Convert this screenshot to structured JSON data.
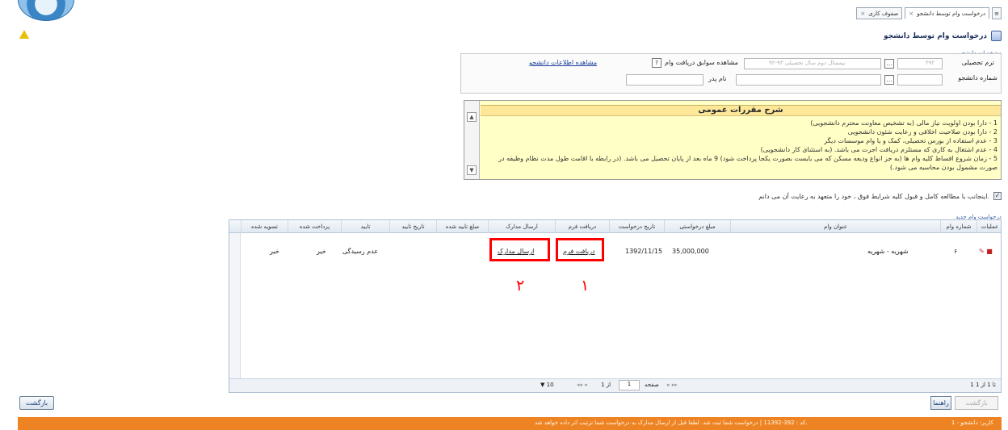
{
  "tabs": [
    {
      "label": "درخواست وام توسط دانشجو",
      "active": true
    },
    {
      "label": "صفوف کاری",
      "active": false
    }
  ],
  "page": {
    "title": "درخواست وام توسط دانشجو"
  },
  "student_info": {
    "legend": "مشخصات دانشجو",
    "term_label": "ترم تحصیلی",
    "term_value": "۴۹۲",
    "term_desc": "نیمسال دوم سال تحصیلی ۹۳-۹۲",
    "student_no_label": "شماره دانشجو",
    "history_label": "مشاهده سوابق دریافت وام",
    "student_details_link": "مشاهده اطلاعات دانشجو",
    "father_label": "نام پدر"
  },
  "rules": {
    "title": "شرح مقررات عمومی",
    "items": [
      "1 - دارا بودن اولویت نیاز مالی (به تشخیص معاونت محترم دانشجویی)",
      "2 - دارا بودن صلاحیت اخلاقی و رعایت شئون دانشجویی",
      "3 - عدم استفاده از بورس تحصیلی، کمک و یا وام موسسات دیگر",
      "4 - عدم اشتغال به کاری که مستلزم دریافت اجرت می باشد. (به استثنای کار دانشجویی)",
      "5 - زمان شروع اقساط کلیه وام ها (به جز انواع ودیعه مسکن که می بایست بصورت یکجا پرداخت شود) 9 ماه بعد از پایان تحصیل می باشد. (در رابطه با اقامت طول مدت نظام وظیفه در صورت مشمول بودن محاسبه می شود.)"
    ]
  },
  "acceptance": {
    "checked": true,
    "text": "اینجانب با مطالعه کامل و قبول کلیه شرایط فوق ، خود را متعهد به رعایت آن می دانم."
  },
  "new_request_link": "درخواست وام جدید",
  "grid": {
    "headers": [
      "عملیات",
      "شماره وام",
      "عنوان وام",
      "مبلغ درخواستی",
      "تاریخ درخواست",
      "دریافت فرم",
      "ارسال مدارک",
      "مبلغ تایید شده",
      "تاریخ تایید",
      "تایید",
      "پرداخت شده",
      "تسویه شده"
    ],
    "rows": [
      {
        "loan_no": "۶",
        "loan_title": "شهریه - شهریه",
        "amount": "35,000,000",
        "date": "1392/11/15",
        "form_link": "دریافت فرم",
        "docs_link": "ارسال مدارک",
        "approved_amount": "",
        "approve_date": "",
        "status": "عدم رسیدگی",
        "paid": "خیر",
        "settled": "خیر"
      }
    ],
    "pager": {
      "page_size": "10",
      "page_label": "صفحه",
      "page": "1",
      "of_label": "از 1",
      "summary": "1 تا 1 از 1"
    }
  },
  "annotations": [
    {
      "number": "۱"
    },
    {
      "number": "۲"
    }
  ],
  "buttons": {
    "print": "بازگشت",
    "help": "راهنما",
    "back": "بازگشت"
  },
  "status_bar": {
    "message": "کد : 392-11392 | درخواست شما ثبت شد. لطفا قبل از ارسال مدارک به درخواست شما ترتیب اثر داده خواهد شد.",
    "right": "1 - کاربر: دانشجو"
  },
  "colors": {
    "status_bar": "#ee8323",
    "rules_bg": "#ffffc6",
    "highlight": "#ff0000",
    "link": "#1a3d9a"
  }
}
